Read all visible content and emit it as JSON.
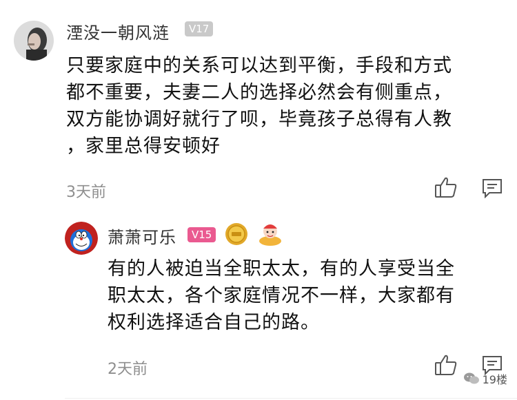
{
  "comments": [
    {
      "username": "湮没一朝风涟",
      "level": "V17",
      "lines": [
        "只要家庭中的关系可以达到平衡，手段和方式",
        "都不重要，夫妻二人的选择必然会有侧重点，",
        "双方能协调好就行了呗，毕竟孩子总得有人教",
        "，家里总得安顿好"
      ],
      "time": "3天前",
      "avatar_icon": "woman-portrait-icon",
      "like_icon": "thumbs-up-icon",
      "reply_icon": "comment-icon"
    },
    {
      "username": "萧萧可乐",
      "level": "V15",
      "lines": [
        "有的人被迫当全职太太，有的人享受当全",
        "职太太，各个家庭情况不一样，大家都有",
        "权利选择适合自己的路。"
      ],
      "time": "2天前",
      "avatar_icon": "doraemon-avatar-icon",
      "medals": [
        "gold-medal-icon",
        "festive-baby-icon"
      ],
      "like_icon": "thumbs-up-icon",
      "reply_icon": "comment-icon"
    }
  ],
  "watermark": {
    "text": "19楼",
    "icon": "wechat-icon"
  },
  "colors": {
    "pink_badge": "#ea5a90",
    "gray_badge": "#c9c9c9",
    "time": "#8e8e8e"
  }
}
